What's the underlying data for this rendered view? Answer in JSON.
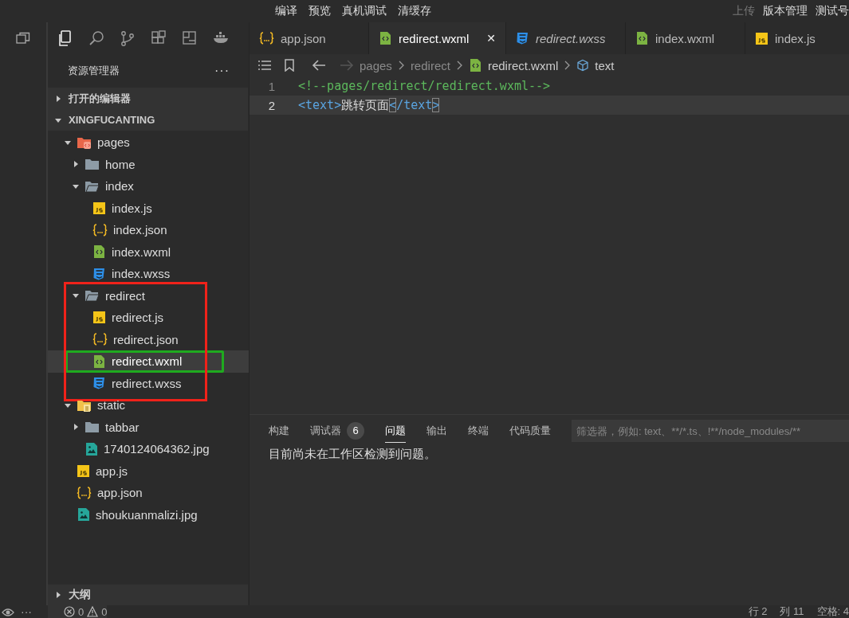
{
  "menu_bar": {
    "center": [
      "编译",
      "预览",
      "真机调试",
      "清缓存"
    ],
    "right": [
      {
        "label": "上传",
        "disabled": true
      },
      {
        "label": "版本管理",
        "disabled": false
      },
      {
        "label": "测试号",
        "disabled": false
      }
    ]
  },
  "explorer": {
    "title": "资源管理器",
    "more": "···",
    "sections": [
      {
        "label": "打开的编辑器",
        "expanded": false
      },
      {
        "label": "XINGFUCANTING",
        "expanded": true,
        "tree": [
          {
            "name": "pages",
            "kind": "pages-folder",
            "expanded": true,
            "selected": false,
            "children": [
              {
                "name": "home",
                "kind": "folder",
                "expanded": false,
                "selected": false
              },
              {
                "name": "index",
                "kind": "folder",
                "expanded": true,
                "selected": false,
                "children": [
                  {
                    "name": "index.js",
                    "kind": "js",
                    "selected": false
                  },
                  {
                    "name": "index.json",
                    "kind": "json",
                    "selected": false
                  },
                  {
                    "name": "index.wxml",
                    "kind": "wxml",
                    "selected": false
                  },
                  {
                    "name": "index.wxss",
                    "kind": "wxss",
                    "selected": false
                  }
                ]
              },
              {
                "name": "redirect",
                "kind": "folder",
                "expanded": true,
                "selected": false,
                "color": "#f0221a",
                "children": [
                  {
                    "name": "redirect.js",
                    "kind": "js",
                    "selected": false
                  },
                  {
                    "name": "redirect.json",
                    "kind": "json",
                    "selected": false
                  },
                  {
                    "name": "redirect.wxml",
                    "kind": "wxml",
                    "selected": true,
                    "color": "#1faa1f"
                  },
                  {
                    "name": "redirect.wxss",
                    "kind": "wxss",
                    "selected": false
                  }
                ]
              }
            ]
          },
          {
            "name": "static",
            "kind": "static-folder",
            "expanded": true,
            "selected": false,
            "children": [
              {
                "name": "tabbar",
                "kind": "folder",
                "expanded": false,
                "selected": false
              },
              {
                "name": "1740124064362.jpg",
                "kind": "image",
                "selected": false
              }
            ]
          },
          {
            "name": "app.js",
            "kind": "js",
            "selected": false
          },
          {
            "name": "app.json",
            "kind": "json",
            "selected": false
          },
          {
            "name": "shoukuanmalizi.jpg",
            "kind": "image",
            "selected": false
          }
        ]
      }
    ],
    "outline": {
      "label": "大纲",
      "expanded": false
    }
  },
  "tabs": [
    {
      "label": "app.json",
      "kind": "json",
      "selected": false,
      "preview": false
    },
    {
      "label": "redirect.wxml",
      "kind": "wxml",
      "selected": true,
      "preview": false,
      "close": "✕"
    },
    {
      "label": "redirect.wxss",
      "kind": "wxss",
      "selected": false,
      "preview": true
    },
    {
      "label": "index.wxml",
      "kind": "wxml",
      "selected": false,
      "preview": false
    },
    {
      "label": "index.js",
      "kind": "js",
      "selected": false,
      "preview": false
    }
  ],
  "breadcrumb": [
    {
      "label": "pages",
      "kind": "folder"
    },
    {
      "label": "redirect",
      "kind": "folder"
    },
    {
      "label": "redirect.wxml",
      "kind": "wxml"
    },
    {
      "label": "text",
      "kind": "element"
    }
  ],
  "code": [
    {
      "number": "1",
      "current": false,
      "tokens": [
        {
          "kind": "comment",
          "text": "<!--pages/redirect/redirect.wxml-->"
        }
      ]
    },
    {
      "number": "2",
      "current": true,
      "tokens": [
        {
          "kind": "tag",
          "text": "<"
        },
        {
          "kind": "tag",
          "text": "text>"
        },
        {
          "kind": "text",
          "text": "跳转页面"
        },
        {
          "kind": "tag",
          "text": "<",
          "match": true
        },
        {
          "kind": "tag",
          "text": "/text"
        },
        {
          "kind": "tag",
          "text": ">",
          "match": true
        }
      ]
    }
  ],
  "panel": {
    "tabs": [
      {
        "label": "构建",
        "selected": false
      },
      {
        "label": "调试器",
        "selected": false,
        "badge": "6"
      },
      {
        "label": "问题",
        "selected": true
      },
      {
        "label": "输出",
        "selected": false
      },
      {
        "label": "终端",
        "selected": false
      },
      {
        "label": "代码质量",
        "selected": false
      }
    ],
    "filter": {
      "placeholder": "筛选器，例如: text、**/*.ts、!**/node_modules/**"
    },
    "message": "目前尚未在工作区检测到问题。"
  },
  "status_bar": {
    "more": "···",
    "errors": "0",
    "warnings": "0",
    "right": [
      "行 2",
      "列 11",
      "空格: 4"
    ]
  }
}
